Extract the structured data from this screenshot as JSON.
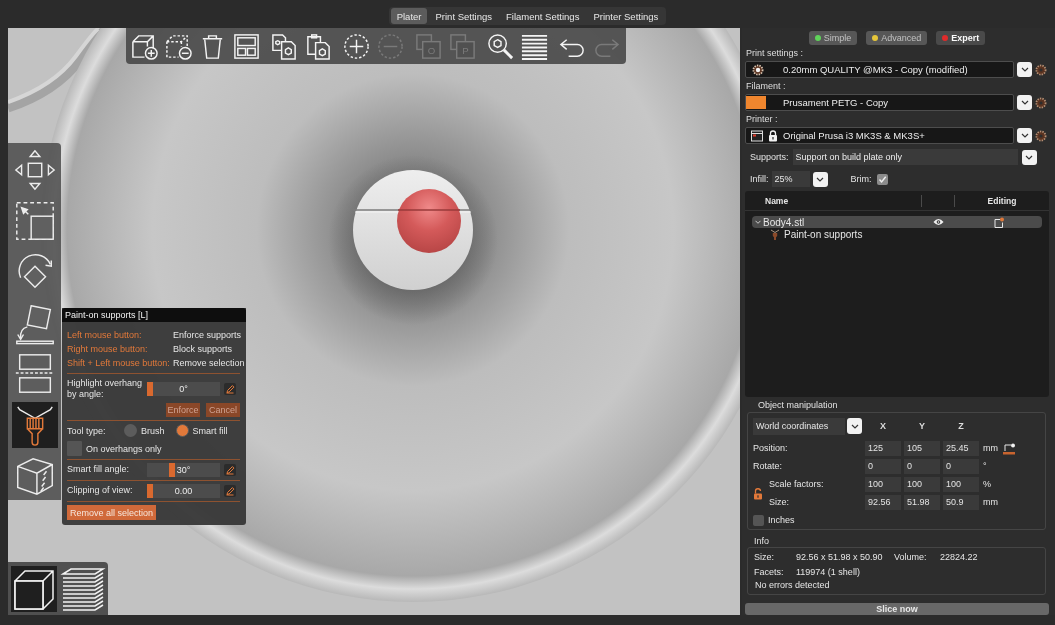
{
  "tabs": [
    {
      "label": "Plater",
      "selected": true
    },
    {
      "label": "Print Settings",
      "selected": false
    },
    {
      "label": "Filament Settings",
      "selected": false
    },
    {
      "label": "Printer Settings",
      "selected": false
    }
  ],
  "top_toolbar": [
    {
      "kind": "add",
      "disabled": false
    },
    {
      "kind": "delete",
      "disabled": false
    },
    {
      "kind": "delete_all",
      "disabled": false
    },
    {
      "kind": "arrange",
      "disabled": false
    },
    {
      "kind": "copy",
      "disabled": false
    },
    {
      "kind": "paste",
      "disabled": false
    },
    {
      "kind": "add_instance",
      "disabled": false
    },
    {
      "kind": "remove_instance",
      "disabled": true
    },
    {
      "kind": "split_objects",
      "disabled": true,
      "letter": "O"
    },
    {
      "kind": "split_parts",
      "disabled": true,
      "letter": "P"
    },
    {
      "kind": "search",
      "disabled": false
    },
    {
      "kind": "layers",
      "disabled": false
    },
    {
      "kind": "undo",
      "disabled": false
    },
    {
      "kind": "redo",
      "disabled": true
    }
  ],
  "gizmos": [
    {
      "kind": "move",
      "selected": false
    },
    {
      "kind": "scale",
      "selected": false
    },
    {
      "kind": "rotate",
      "selected": false
    },
    {
      "kind": "place",
      "selected": false
    },
    {
      "kind": "cut",
      "selected": false
    },
    {
      "kind": "supports",
      "selected": true
    },
    {
      "kind": "seam",
      "selected": false
    }
  ],
  "views": [
    {
      "kind": "model",
      "selected": true
    },
    {
      "kind": "preview",
      "selected": false
    }
  ],
  "paint_popup": {
    "title": "Paint-on supports [L]",
    "hints": [
      {
        "key": "Left mouse button:",
        "action": "Enforce supports"
      },
      {
        "key": "Right mouse button:",
        "action": "Block supports"
      },
      {
        "key": "Shift + Left mouse button:",
        "action": "Remove selection"
      }
    ],
    "overhang": {
      "label": "Highlight overhang by angle:",
      "value": "0°",
      "level": 0
    },
    "buttons": [
      "Enforce",
      "Cancel"
    ],
    "tool_type": {
      "label": "Tool type:",
      "options": [
        {
          "label": "Brush",
          "selected": false
        },
        {
          "label": "Smart fill",
          "selected": true
        }
      ]
    },
    "on_overhangs_only": {
      "label": "On overhangs only",
      "checked": false
    },
    "smart_fill_angle": {
      "label": "Smart fill angle:",
      "value": "30°",
      "level": 0.33
    },
    "clipping": {
      "label": "Clipping of view:",
      "value": "0.00",
      "level": 0
    },
    "remove_all": "Remove all selection"
  },
  "modes": [
    {
      "label": "Simple",
      "color": "#5fd35a",
      "selected": false
    },
    {
      "label": "Advanced",
      "color": "#e6c63a",
      "selected": false
    },
    {
      "label": "Expert",
      "color": "#e02b2b",
      "selected": true
    }
  ],
  "presets": [
    {
      "kind": "print",
      "label": "Print settings :",
      "value": "0.20mm QUALITY @MK3 - Copy (modified)"
    },
    {
      "kind": "filament",
      "label": "Filament :",
      "value": "Prusament PETG - Copy",
      "color": "#f0862e"
    },
    {
      "kind": "printer",
      "label": "Printer :",
      "value": "Original Prusa i3 MK3S & MK3S+"
    }
  ],
  "supports": {
    "label": "Supports:",
    "value": "Support on build plate only"
  },
  "infill": {
    "label": "Infill:",
    "value": "25%"
  },
  "brim": {
    "label": "Brim:",
    "checked": true
  },
  "object_list": {
    "columns": [
      "Name",
      "Editing"
    ],
    "items": [
      {
        "name": "Body4.stl",
        "expanded": true,
        "selected": true,
        "children": [
          {
            "name": "Paint-on supports"
          }
        ]
      }
    ]
  },
  "object_manipulation": {
    "title": "Object manipulation",
    "coordinates": "World coordinates",
    "axes": [
      "X",
      "Y",
      "Z"
    ],
    "rows": [
      {
        "kind": "position",
        "label": "Position:",
        "values": [
          "125",
          "105",
          "25.45"
        ],
        "unit": "mm"
      },
      {
        "kind": "rotation",
        "label": "Rotate:",
        "values": [
          "0",
          "0",
          "0"
        ],
        "unit": "°"
      },
      {
        "kind": "scale",
        "label": "Scale factors:",
        "values": [
          "100",
          "100",
          "100"
        ],
        "unit": "%"
      },
      {
        "kind": "size",
        "label": "Size:",
        "values": [
          "92.56",
          "51.98",
          "50.9"
        ],
        "unit": "mm"
      }
    ],
    "inches": {
      "label": "Inches",
      "checked": false
    }
  },
  "info": {
    "title": "Info",
    "size_label": "Size:",
    "size": "92.56 x 51.98 x 50.90",
    "volume_label": "Volume:",
    "volume": "22824.22",
    "facets_label": "Facets:",
    "facets": "119974 (1 shell)",
    "status": "No errors detected"
  },
  "slice_button": "Slice now"
}
